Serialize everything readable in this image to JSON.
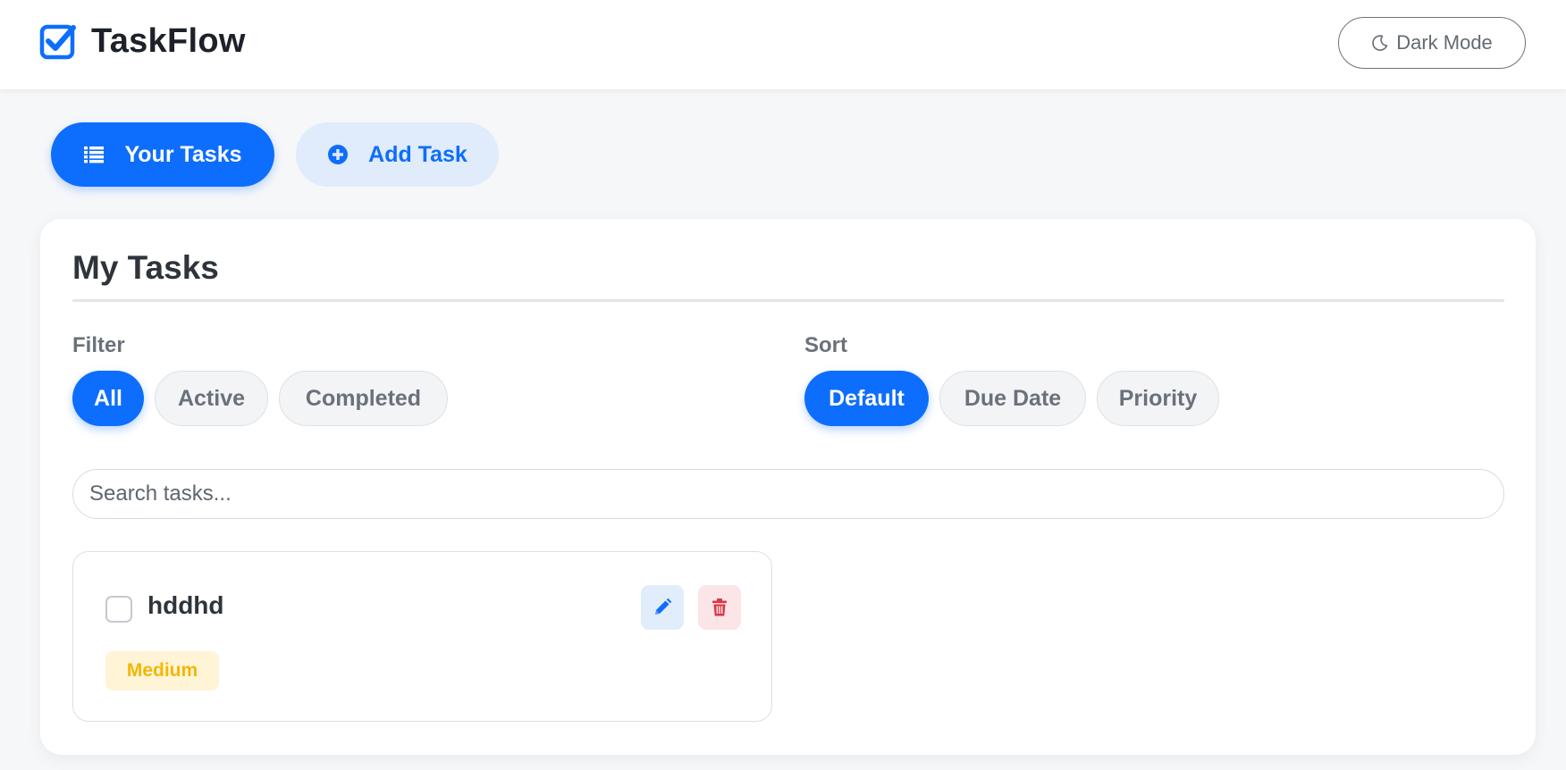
{
  "app": {
    "name": "TaskFlow",
    "theme_toggle_label": "Dark Mode"
  },
  "nav": {
    "tabs": [
      {
        "label": "Your Tasks",
        "icon": "list-icon",
        "active": true
      },
      {
        "label": "Add Task",
        "icon": "plus-circle-icon",
        "active": false
      }
    ]
  },
  "main": {
    "title": "My Tasks",
    "filter": {
      "label": "Filter",
      "options": [
        "All",
        "Active",
        "Completed"
      ],
      "selected": "All"
    },
    "sort": {
      "label": "Sort",
      "options": [
        "Default",
        "Due Date",
        "Priority"
      ],
      "selected": "Default"
    },
    "search": {
      "placeholder": "Search tasks...",
      "value": ""
    },
    "tasks": [
      {
        "title": "hddhd",
        "priority": "Medium",
        "completed": false
      }
    ]
  },
  "colors": {
    "accent": "#0d6efd",
    "accent_light": "#e0ebfb",
    "danger": "#dc3545",
    "priority_medium": "#f2b705",
    "priority_medium_bg": "#fff4d6"
  }
}
